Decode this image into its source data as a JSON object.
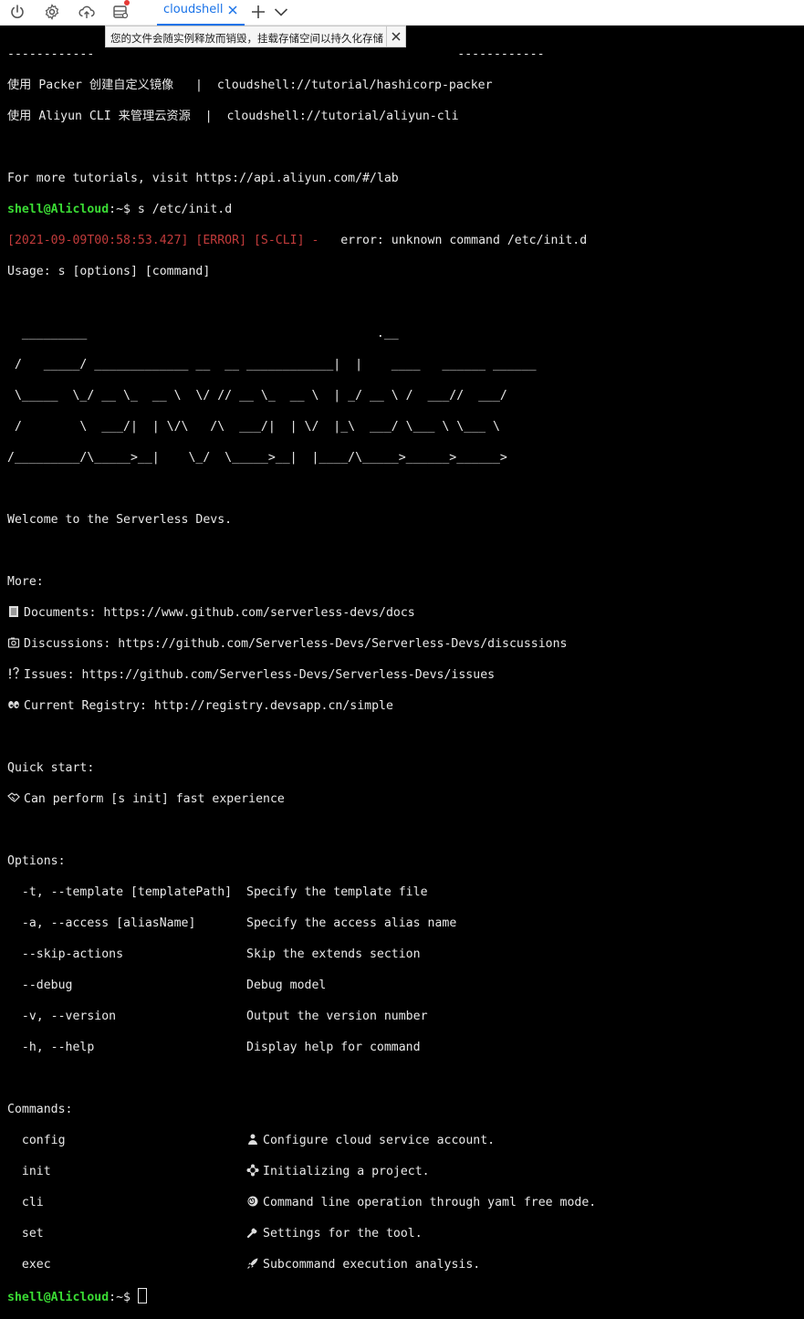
{
  "toolbar": {
    "tab_label": "cloudshell",
    "icons": [
      "power-icon",
      "gear-icon",
      "cloud-upload-icon",
      "file-server-icon",
      "add-icon",
      "chevron-down-icon"
    ],
    "accent": "#1a73e8",
    "notification_dot": "#e53935"
  },
  "notice": {
    "text": "您的文件会随实例释放而销毁，挂载存储空间以持久化存储"
  },
  "terminal": {
    "sep_left": "------------",
    "sep_right": "------------",
    "tutorial1": "使用 Packer 创建自定义镜像   |  cloudshell://tutorial/hashicorp-packer",
    "tutorial2": "使用 Aliyun CLI 来管理云资源  |  cloudshell://tutorial/aliyun-cli",
    "more_tutorials": "For more tutorials, visit https://api.aliyun.com/#/lab",
    "prompt_user": "shell@Alicloud",
    "prompt_sep": ":~$ ",
    "command": "s /etc/init.d",
    "error_prefix": "[2021-09-09T00:58:53.427] [ERROR] [S-CLI] -",
    "error_msg": "   error: unknown command /etc/init.d",
    "usage": "Usage: s [options] [command]",
    "banner": [
      "  _________                                        .__",
      " /   _____/ _____________ __  __ ____________|  |    ____   ______ ______",
      " \\_____  \\_/ __ \\_  __ \\  \\/ // __ \\_  __ \\  | _/ __ \\ /  ___//  ___/",
      " /        \\  ___/|  | \\/\\   /\\  ___/|  | \\/  |_\\  ___/ \\___ \\ \\___ \\",
      "/_________/\\_____>__|    \\_/  \\_____>__|  |____/\\_____>______>______>"
    ],
    "welcome": "Welcome to the Serverless Devs.",
    "more_label": "More:",
    "more_items": [
      {
        "icon": "book-icon",
        "text": "Documents: https://www.github.com/serverless-devs/docs"
      },
      {
        "icon": "camera-icon",
        "text": "Discussions: https://github.com/Serverless-Devs/Serverless-Devs/discussions"
      },
      {
        "icon": "exclamation-question-icon",
        "text": "Issues: https://github.com/Serverless-Devs/Serverless-Devs/issues"
      },
      {
        "icon": "eyes-icon",
        "text": "Current Registry: http://registry.devsapp.cn/simple"
      }
    ],
    "quickstart_label": "Quick start:",
    "quickstart_item": {
      "icon": "handshake-icon",
      "text": "Can perform [s init] fast experience"
    },
    "options_label": "Options:",
    "options": [
      {
        "flag": "  -t, --template [templatePath]  ",
        "desc": "Specify the template file"
      },
      {
        "flag": "  -a, --access [aliasName]       ",
        "desc": "Specify the access alias name"
      },
      {
        "flag": "  --skip-actions                 ",
        "desc": "Skip the extends section"
      },
      {
        "flag": "  --debug                        ",
        "desc": "Debug model"
      },
      {
        "flag": "  -v, --version                  ",
        "desc": "Output the version number"
      },
      {
        "flag": "  -h, --help                     ",
        "desc": "Display help for command"
      }
    ],
    "commands_label": "Commands:",
    "commands": [
      {
        "name": "  config                         ",
        "icon": "person-icon",
        "desc": "Configure cloud service account."
      },
      {
        "name": "  init                           ",
        "icon": "network-icon",
        "desc": "Initializing a project."
      },
      {
        "name": "  cli                            ",
        "icon": "spiral-icon",
        "desc": "Command line operation through yaml free mode."
      },
      {
        "name": "  set                            ",
        "icon": "wrench-icon",
        "desc": "Settings for the tool."
      },
      {
        "name": "  exec                           ",
        "icon": "rocket-icon",
        "desc": "Subcommand execution analysis."
      }
    ],
    "final_prompt_user": "shell@Alicloud",
    "final_prompt_sep": ":~$ "
  }
}
